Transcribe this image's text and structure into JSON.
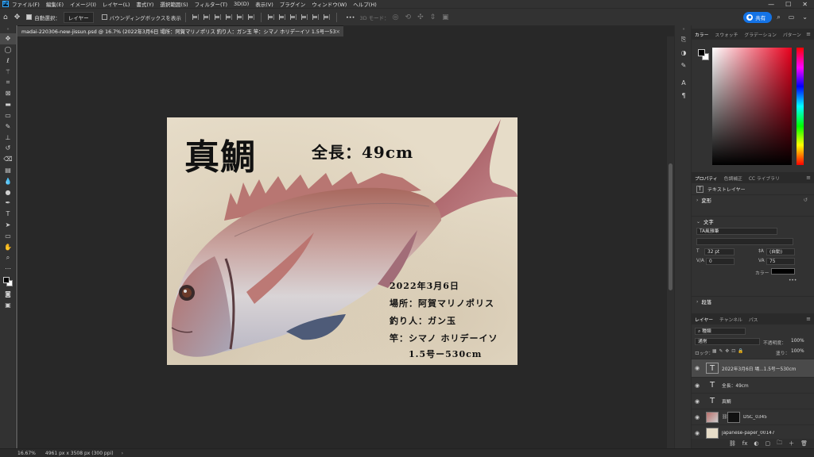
{
  "menubar": {
    "logo": "Ps",
    "items": [
      "ファイル(F)",
      "編集(E)",
      "イメージ(I)",
      "レイヤー(L)",
      "書式(Y)",
      "選択範囲(S)",
      "フィルター(T)",
      "3D(D)",
      "表示(V)",
      "プラグイン",
      "ウィンドウ(W)",
      "ヘルプ(H)"
    ],
    "controls": [
      "—",
      "☐",
      "✕"
    ]
  },
  "options": {
    "auto_select_label": "自動選択：",
    "auto_select_target": "レイヤー",
    "bbox_label": "バウンディングボックスを表示",
    "mode3d_label": "3D モード：",
    "more": "•••",
    "share_label": "共有"
  },
  "tab": {
    "title": "madai-220306-new-jissun.psd @ 16.7% (2022年3月6日  場所：阿賀マリノポリス  釣り人：ガン玉  竿：シマノ ホリデーイソ        1.5号ー530cm, RGB/8)",
    "close": "×"
  },
  "document": {
    "fish_name": "真鯛",
    "length_text": "全長：49cm",
    "date": "2022年3月6日",
    "place": "場所：阿賀マリノポリス",
    "angler": "釣り人：ガン玉",
    "rod": "竿：シマノ ホリデーイソ",
    "rod_spec": "1.5号ー530cm"
  },
  "status": {
    "zoom": "16.67%",
    "doc_info": "4961 px x 3508 px (300 ppi)",
    "arrow": "›"
  },
  "color_panel": {
    "tabs": [
      "カラー",
      "スウォッチ",
      "グラデーション",
      "パターン"
    ],
    "active_tab": 0
  },
  "properties_panel": {
    "tabs": [
      "プロパティ",
      "色調補正",
      "CC ライブラリ"
    ],
    "layer_type": "テキストレイヤー",
    "transform_label": "変形",
    "char_label": "文字",
    "font_family": "TA風雅筆",
    "font_size": "32 pt",
    "leading": "(自動)",
    "kerning": "0",
    "tracking": "75",
    "color_label": "カラー",
    "more": "•••",
    "paragraph_label": "段落"
  },
  "layers_panel": {
    "tabs": [
      "レイヤー",
      "チャンネル",
      "パス"
    ],
    "filter_label": "種類",
    "blend_mode": "通常",
    "opacity_label": "不透明度：",
    "opacity_value": "100%",
    "lock_label": "ロック：",
    "fill_label": "塗り：",
    "fill_value": "100%",
    "layers": [
      {
        "name": "2022年3月6日 場...1.5号ー530cm",
        "type": "text",
        "selected": true
      },
      {
        "name": "全長：49cm",
        "type": "text",
        "selected": false
      },
      {
        "name": "真鯛",
        "type": "text",
        "selected": false
      },
      {
        "name": "DSC_0345",
        "type": "image",
        "selected": false
      },
      {
        "name": "japanese-paper_00147",
        "type": "image",
        "selected": false
      }
    ],
    "footer_icons": [
      "⛓",
      "fx",
      "◐",
      "▢",
      "🗀",
      "＋",
      "🗑"
    ]
  },
  "colors": {
    "accent": "#1473e6",
    "chrome_dark": "#323232",
    "canvas_bg": "#282828"
  }
}
